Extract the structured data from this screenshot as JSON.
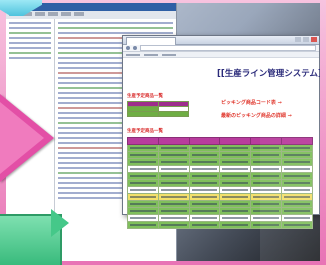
{
  "ide": {
    "title": "",
    "menu_count": 6
  },
  "browser": {
    "tab_label": ""
  },
  "app": {
    "system_title": "[[生産ライン管理システム]]",
    "section_pending": "生産予定商品一覧",
    "section_list": "生産予定商品一覧",
    "picking_code_label": "ピッキング商品コード表 →",
    "picking_latest_label": "最新のピッキング商品の詳細 →"
  },
  "colors": {
    "frame_pink": "#e873b5",
    "table_header_purple": "#b83c9d",
    "table_row_green": "#7fbf5b",
    "label_red": "#e0352b",
    "title_navy": "#2a2a7a"
  }
}
